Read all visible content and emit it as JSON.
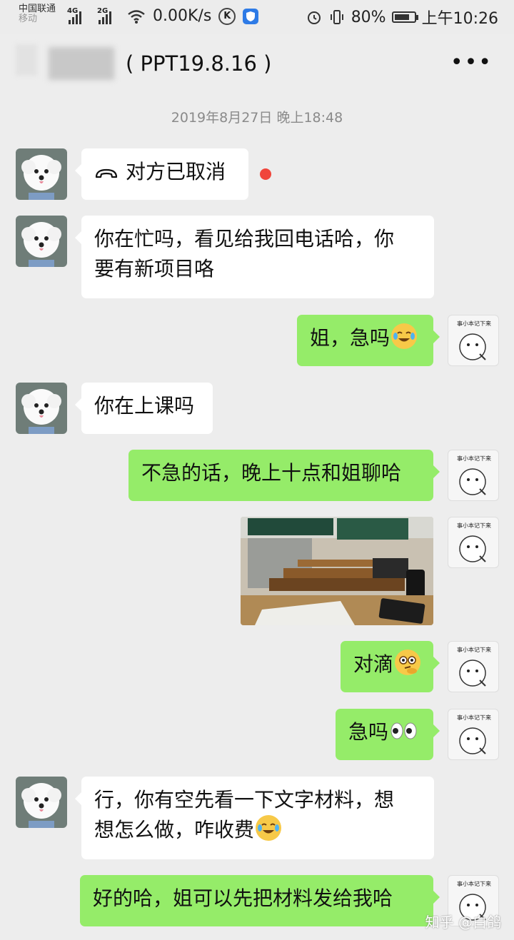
{
  "status_bar": {
    "carrier": "中国联通",
    "carrier_sub": "移动",
    "network_1": "4G",
    "network_2": "2G",
    "speed": "0.00K/s",
    "battery": "80%",
    "battery_level": 0.8,
    "time": "上午10:26"
  },
  "header": {
    "title": "( PPT19.8.16 )",
    "more_label": "•••"
  },
  "chat": {
    "timestamp": "2019年8月27日 晚上18:48",
    "messages": [
      {
        "side": "in",
        "text": "对方已取消",
        "type": "call-cancelled"
      },
      {
        "side": "in",
        "text_line1": "你在忙吗，看见给我回电话哈，你",
        "text_line2": "要有新项目咯"
      },
      {
        "side": "out",
        "text": "姐，急吗"
      },
      {
        "side": "in",
        "text": "你在上课吗"
      },
      {
        "side": "out",
        "text": "不急的话，晚上十点和姐聊哈"
      },
      {
        "side": "out",
        "type": "photo"
      },
      {
        "side": "out",
        "text": "对滴"
      },
      {
        "side": "out",
        "text": "急吗"
      },
      {
        "side": "in",
        "text_line1": "行，你有空先看一下文字材料，想",
        "text_line2": "想怎么做，咋收费"
      },
      {
        "side": "out",
        "text": "好的哈，姐可以先把材料发给我哈"
      }
    ]
  },
  "my_avatar": {
    "caption": "事小本记下来"
  },
  "watermark": "知乎 @白鸽",
  "colors": {
    "out_bubble": "#95ec69",
    "in_bubble": "#ffffff",
    "background": "#ededed",
    "unread_dot": "#f0453b"
  }
}
